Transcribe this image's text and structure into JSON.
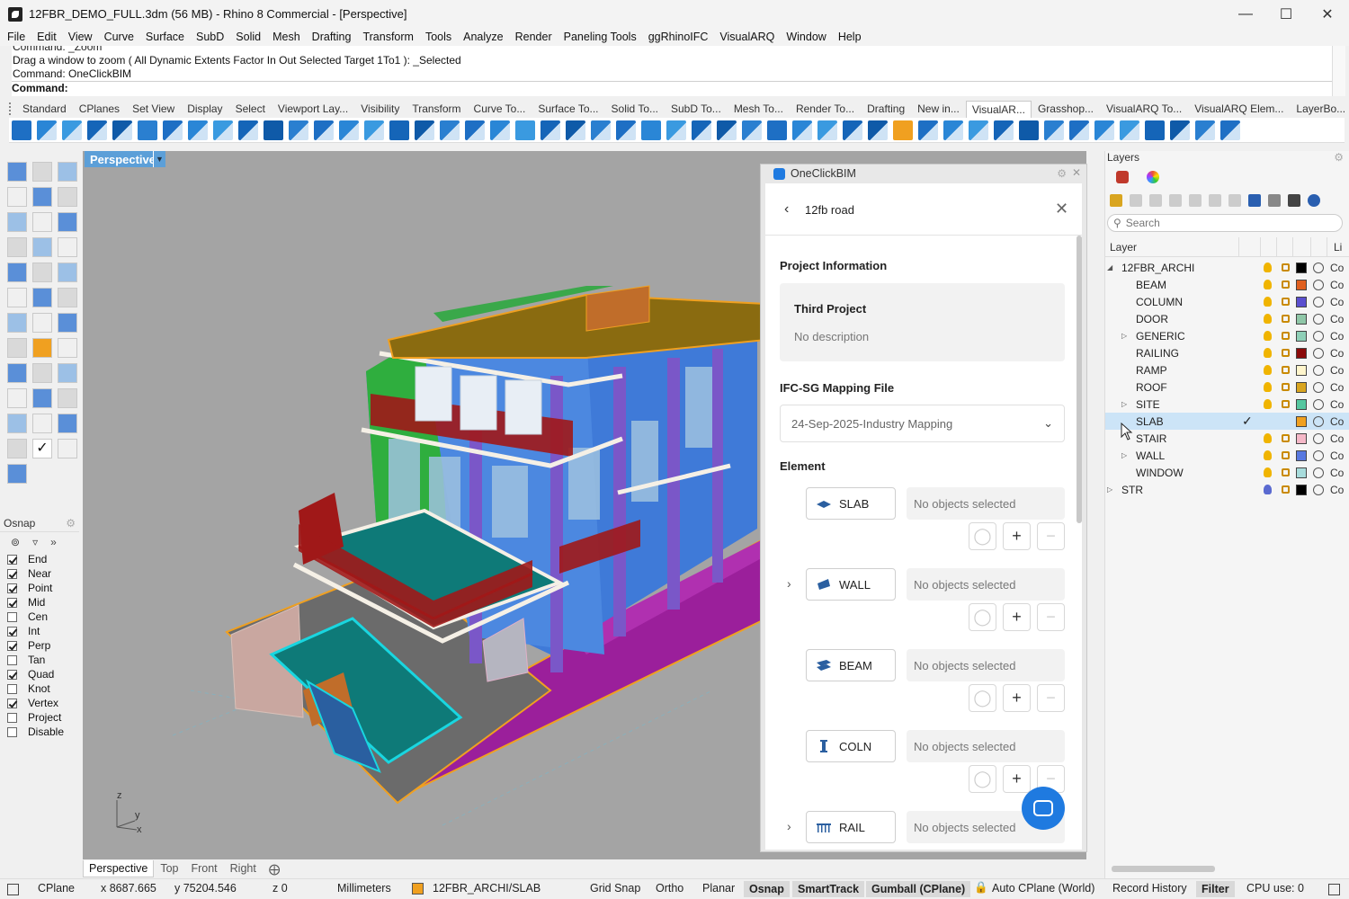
{
  "window": {
    "title": "12FBR_DEMO_FULL.3dm (56 MB) - Rhino 8 Commercial - [Perspective]"
  },
  "menu": [
    "File",
    "Edit",
    "View",
    "Curve",
    "Surface",
    "SubD",
    "Solid",
    "Mesh",
    "Drafting",
    "Transform",
    "Tools",
    "Analyze",
    "Render",
    "Paneling Tools",
    "ggRhinoIFC",
    "VisualARQ",
    "Window",
    "Help"
  ],
  "command": {
    "history": [
      "Command: _Zoom",
      "Drag a window to zoom ( All  Dynamic  Extents  Factor  In  Out  Selected  Target  1To1 ): _Selected",
      "Command: OneClickBIM"
    ],
    "prompt": "Command:"
  },
  "toolbar_tabs": [
    "Standard",
    "CPlanes",
    "Set View",
    "Display",
    "Select",
    "Viewport Lay...",
    "Visibility",
    "Transform",
    "Curve To...",
    "Surface To...",
    "Solid To...",
    "SubD To...",
    "Mesh To...",
    "Render To...",
    "Drafting",
    "New in...",
    "VisualAR...",
    "Grasshop...",
    "VisualARQ To...",
    "VisualARQ Elem...",
    "LayerBo..."
  ],
  "active_toolbar_tab": "VisualAR...",
  "osnap": {
    "title": "Osnap",
    "items": [
      {
        "label": "End",
        "checked": true
      },
      {
        "label": "Near",
        "checked": true
      },
      {
        "label": "Point",
        "checked": true
      },
      {
        "label": "Mid",
        "checked": true
      },
      {
        "label": "Cen",
        "checked": false
      },
      {
        "label": "Int",
        "checked": true
      },
      {
        "label": "Perp",
        "checked": true
      },
      {
        "label": "Tan",
        "checked": false
      },
      {
        "label": "Quad",
        "checked": true
      },
      {
        "label": "Knot",
        "checked": false
      },
      {
        "label": "Vertex",
        "checked": true
      },
      {
        "label": "Project",
        "checked": false
      },
      {
        "label": "Disable",
        "checked": false
      }
    ]
  },
  "viewport": {
    "label": "Perspective",
    "tabs": [
      "Perspective",
      "Top",
      "Front",
      "Right"
    ],
    "active_tab": "Perspective"
  },
  "panel": {
    "title": "OneClickBIM",
    "header": "12fb road",
    "project_section": "Project Information",
    "project_name": "Third Project",
    "project_desc": "No description",
    "mapping_section": "IFC-SG Mapping File",
    "mapping_value": "24-Sep-2025-Industry Mapping",
    "element_section": "Element",
    "elements": [
      {
        "label": "SLAB",
        "status": "No objects selected",
        "expandable": false
      },
      {
        "label": "WALL",
        "status": "No objects selected",
        "expandable": true
      },
      {
        "label": "BEAM",
        "status": "No objects selected",
        "expandable": false
      },
      {
        "label": "COLN",
        "status": "No objects selected",
        "expandable": false
      },
      {
        "label": "RAIL",
        "status": "No objects selected",
        "expandable": true
      }
    ]
  },
  "layers": {
    "title": "Layers",
    "search_placeholder": "Search",
    "col_layer": "Layer",
    "col_linetype": "Li",
    "rows": [
      {
        "name": "12FBR_ARCHI",
        "level": 0,
        "expander": "open",
        "color": "#000000",
        "linetype": "Co"
      },
      {
        "name": "BEAM",
        "level": 1,
        "expander": "",
        "color": "#e06020",
        "linetype": "Co"
      },
      {
        "name": "COLUMN",
        "level": 1,
        "expander": "",
        "color": "#5a4fcf",
        "linetype": "Co"
      },
      {
        "name": "DOOR",
        "level": 1,
        "expander": "",
        "color": "#8fc7a8",
        "linetype": "Co"
      },
      {
        "name": "GENERIC",
        "level": 1,
        "expander": "closed",
        "color": "#8fd0b8",
        "linetype": "Co"
      },
      {
        "name": "RAILING",
        "level": 1,
        "expander": "",
        "color": "#8b0a0a",
        "linetype": "Co"
      },
      {
        "name": "RAMP",
        "level": 1,
        "expander": "",
        "color": "#fff5cc",
        "linetype": "Co"
      },
      {
        "name": "ROOF",
        "level": 1,
        "expander": "",
        "color": "#d9a520",
        "linetype": "Co"
      },
      {
        "name": "SITE",
        "level": 1,
        "expander": "closed",
        "color": "#55c7a0",
        "linetype": "Co"
      },
      {
        "name": "SLAB",
        "level": 1,
        "expander": "",
        "color": "#f0a020",
        "linetype": "Co",
        "selected": true,
        "current": true
      },
      {
        "name": "STAIR",
        "level": 1,
        "expander": "",
        "color": "#f5b8c8",
        "linetype": "Co"
      },
      {
        "name": "WALL",
        "level": 1,
        "expander": "closed",
        "color": "#5878e0",
        "linetype": "Co"
      },
      {
        "name": "WINDOW",
        "level": 1,
        "expander": "",
        "color": "#a8dcdc",
        "linetype": "Co"
      },
      {
        "name": "STR",
        "level": 0,
        "expander": "closed",
        "color": "#000000",
        "linetype": "Co",
        "bulb_color": "#5a6ad0"
      }
    ]
  },
  "status": {
    "cplane": "CPlane",
    "x": "x 8687.665",
    "y": "y 75204.546",
    "z": "z 0",
    "units": "Millimeters",
    "layer": "12FBR_ARCHI/SLAB",
    "grid_snap": "Grid Snap",
    "ortho": "Ortho",
    "planar": "Planar",
    "osnap": "Osnap",
    "smarttrack": "SmartTrack",
    "gumball": "Gumball (CPlane)",
    "autocplane": "Auto CPlane (World)",
    "record_history": "Record History",
    "filter": "Filter",
    "cpu": "CPU use: 0"
  },
  "colors": {
    "accent": "#1f7ae0",
    "viewport_label": "#5c9fd8",
    "selection": "#cce4f7",
    "viewport_bg": "#a4a4a4"
  }
}
